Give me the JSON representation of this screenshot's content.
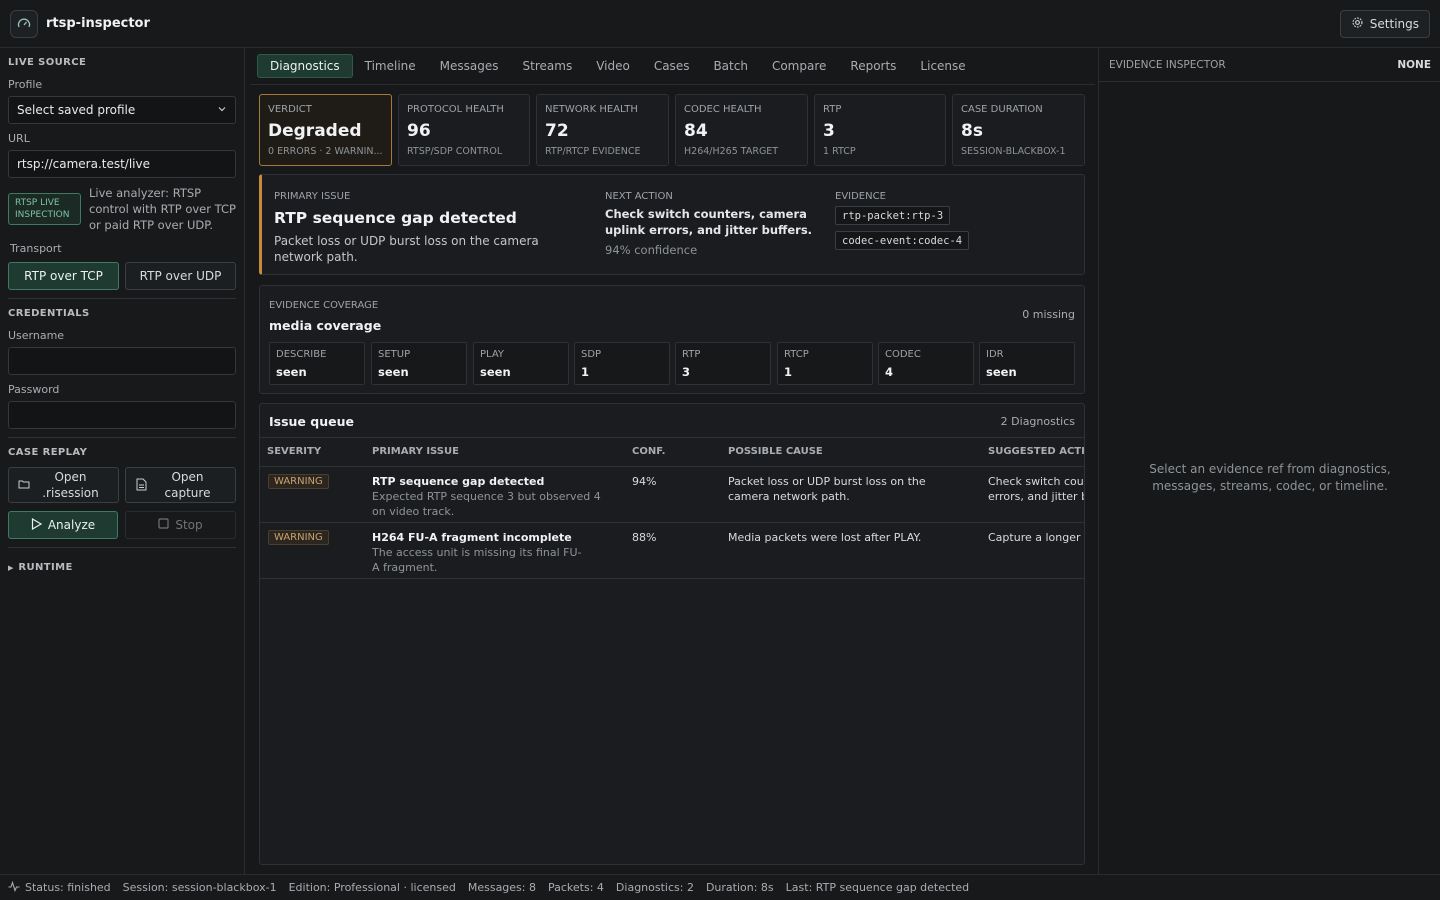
{
  "app": {
    "title": "rtsp-inspector",
    "settings_label": "Settings"
  },
  "sidebar": {
    "live_source_title": "LIVE SOURCE",
    "profile_label": "Profile",
    "profile_value": "Select saved profile",
    "url_label": "URL",
    "url_value": "rtsp://camera.test/live",
    "badge_line1": "RTSP LIVE",
    "badge_line2": "INSPECTION",
    "analyzer_text": "Live analyzer: RTSP control with RTP over TCP or paid RTP over UDP.",
    "transport_label": "Transport",
    "transport_tcp": "RTP over TCP",
    "transport_udp": "RTP over UDP",
    "credentials_title": "CREDENTIALS",
    "username_label": "Username",
    "username_value": "",
    "password_label": "Password",
    "password_value": "",
    "case_replay_title": "CASE REPLAY",
    "open_session_line1": "Open",
    "open_session_line2": ".risession",
    "open_capture_line1": "Open",
    "open_capture_line2": "capture",
    "analyze_label": "Analyze",
    "stop_label": "Stop",
    "runtime_title": "RUNTIME"
  },
  "tabs": [
    "Diagnostics",
    "Timeline",
    "Messages",
    "Streams",
    "Video",
    "Cases",
    "Batch",
    "Compare",
    "Reports",
    "License"
  ],
  "active_tab": "Diagnostics",
  "summary_cards": [
    {
      "key": "VERDICT",
      "value": "Degraded",
      "sub": "0 ERRORS · 2 WARNIN..."
    },
    {
      "key": "PROTOCOL HEALTH",
      "value": "96",
      "sub": "RTSP/SDP CONTROL"
    },
    {
      "key": "NETWORK HEALTH",
      "value": "72",
      "sub": "RTP/RTCP EVIDENCE"
    },
    {
      "key": "CODEC HEALTH",
      "value": "84",
      "sub": "H264/H265 TARGET"
    },
    {
      "key": "RTP",
      "value": "3",
      "sub": "1 RTCP"
    },
    {
      "key": "CASE DURATION",
      "value": "8s",
      "sub": "SESSION-BLACKBOX-1"
    }
  ],
  "primary": {
    "label": "PRIMARY ISSUE",
    "title": "RTP sequence gap detected",
    "desc": "Packet loss or UDP burst loss on the camera network path.",
    "next_label": "NEXT ACTION",
    "next_text": "Check switch counters, camera uplink errors, and jitter buffers.",
    "confidence": "94% confidence",
    "evidence_label": "EVIDENCE",
    "evidence": [
      "rtp-packet:rtp-3",
      "codec-event:codec-4"
    ]
  },
  "coverage": {
    "label": "EVIDENCE COVERAGE",
    "title": "media coverage",
    "missing": "0 missing",
    "items": [
      {
        "k": "DESCRIBE",
        "v": "seen"
      },
      {
        "k": "SETUP",
        "v": "seen"
      },
      {
        "k": "PLAY",
        "v": "seen"
      },
      {
        "k": "SDP",
        "v": "1"
      },
      {
        "k": "RTP",
        "v": "3"
      },
      {
        "k": "RTCP",
        "v": "1"
      },
      {
        "k": "CODEC",
        "v": "4"
      },
      {
        "k": "IDR",
        "v": "seen"
      }
    ]
  },
  "queue": {
    "title": "Issue queue",
    "count": "2 Diagnostics",
    "headers": [
      "SEVERITY",
      "PRIMARY ISSUE",
      "CONF.",
      "POSSIBLE CAUSE",
      "SUGGESTED ACTION"
    ],
    "rows": [
      {
        "severity": "WARNING",
        "issue": "RTP sequence gap detected",
        "detail": "Expected RTP sequence 3 but observed 4 on video track.",
        "conf": "94%",
        "cause": "Packet loss or UDP burst loss on the camera network path.",
        "action": "Check switch counters, camera uplink errors, and jitter buffers."
      },
      {
        "severity": "WARNING",
        "issue": "H264 FU-A fragment incomplete",
        "detail": "The access unit is missing its final FU-A fragment.",
        "conf": "88%",
        "cause": "Media packets were lost after PLAY.",
        "action": "Capture a longer sample"
      }
    ]
  },
  "inspector": {
    "title": "EVIDENCE INSPECTOR",
    "state": "NONE",
    "empty_text": "Select an evidence ref from diagnostics, messages, streams, codec, or timeline."
  },
  "status": {
    "status": "Status: finished",
    "session": "Session: session-blackbox-1",
    "edition": "Edition: Professional · licensed",
    "messages": "Messages: 8",
    "packets": "Packets: 4",
    "diagnostics": "Diagnostics: 2",
    "duration": "Duration: 8s",
    "last": "Last: RTP sequence gap detected"
  }
}
